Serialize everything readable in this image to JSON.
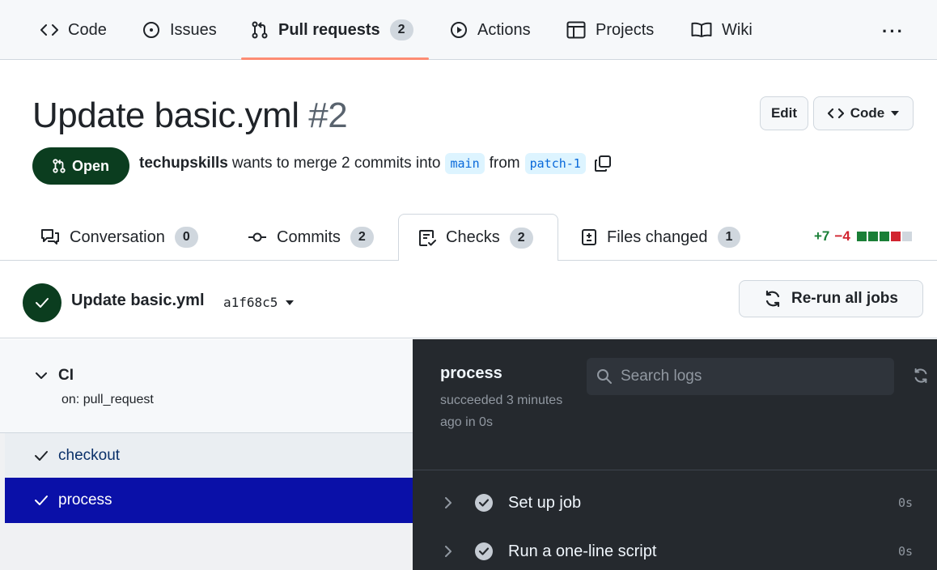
{
  "repo_nav": {
    "items": [
      {
        "label": "Code",
        "icon": "code-icon"
      },
      {
        "label": "Issues",
        "icon": "issue-icon"
      },
      {
        "label": "Pull requests",
        "icon": "pull-request-icon",
        "count": "2",
        "active": true
      },
      {
        "label": "Actions",
        "icon": "play-icon"
      },
      {
        "label": "Projects",
        "icon": "table-icon"
      },
      {
        "label": "Wiki",
        "icon": "book-icon"
      }
    ],
    "more_label": "···"
  },
  "pr": {
    "title": "Update basic.yml",
    "number": "#2",
    "edit_label": "Edit",
    "code_label": "Code",
    "state": "Open",
    "author": "techupskills",
    "merge_text": "wants to merge 2 commits into",
    "base_branch": "main",
    "from_text": "from",
    "head_branch": "patch-1"
  },
  "tabs": [
    {
      "label": "Conversation",
      "count": "0",
      "icon": "comment-discussion-icon"
    },
    {
      "label": "Commits",
      "count": "2",
      "icon": "commit-icon"
    },
    {
      "label": "Checks",
      "count": "2",
      "icon": "checklist-icon",
      "active": true
    },
    {
      "label": "Files changed",
      "count": "1",
      "icon": "file-diff-icon"
    }
  ],
  "diffstat": {
    "additions": "+7",
    "deletions": "−4"
  },
  "check_run": {
    "title": "Update basic.yml",
    "sha": "a1f68c5",
    "rerun_label": "Re-run all jobs"
  },
  "workflow": {
    "name": "CI",
    "trigger": "on: pull_request",
    "jobs": [
      {
        "label": "checkout",
        "status": "success"
      },
      {
        "label": "process",
        "status": "success",
        "selected": true
      }
    ]
  },
  "job_log": {
    "title": "process",
    "status_text": "succeeded 3 minutes ago in 0s",
    "search_placeholder": "Search logs",
    "steps": [
      {
        "label": "Set up job",
        "duration": "0s"
      },
      {
        "label": "Run a one-line script",
        "duration": "0s"
      }
    ]
  },
  "colors": {
    "accent_underline": "#fd8c73",
    "open_badge": "#0b3d1f",
    "selected_job": "#0a10a8",
    "log_bg": "#25292e",
    "additions": "#1a7f37",
    "deletions": "#d1242f"
  }
}
